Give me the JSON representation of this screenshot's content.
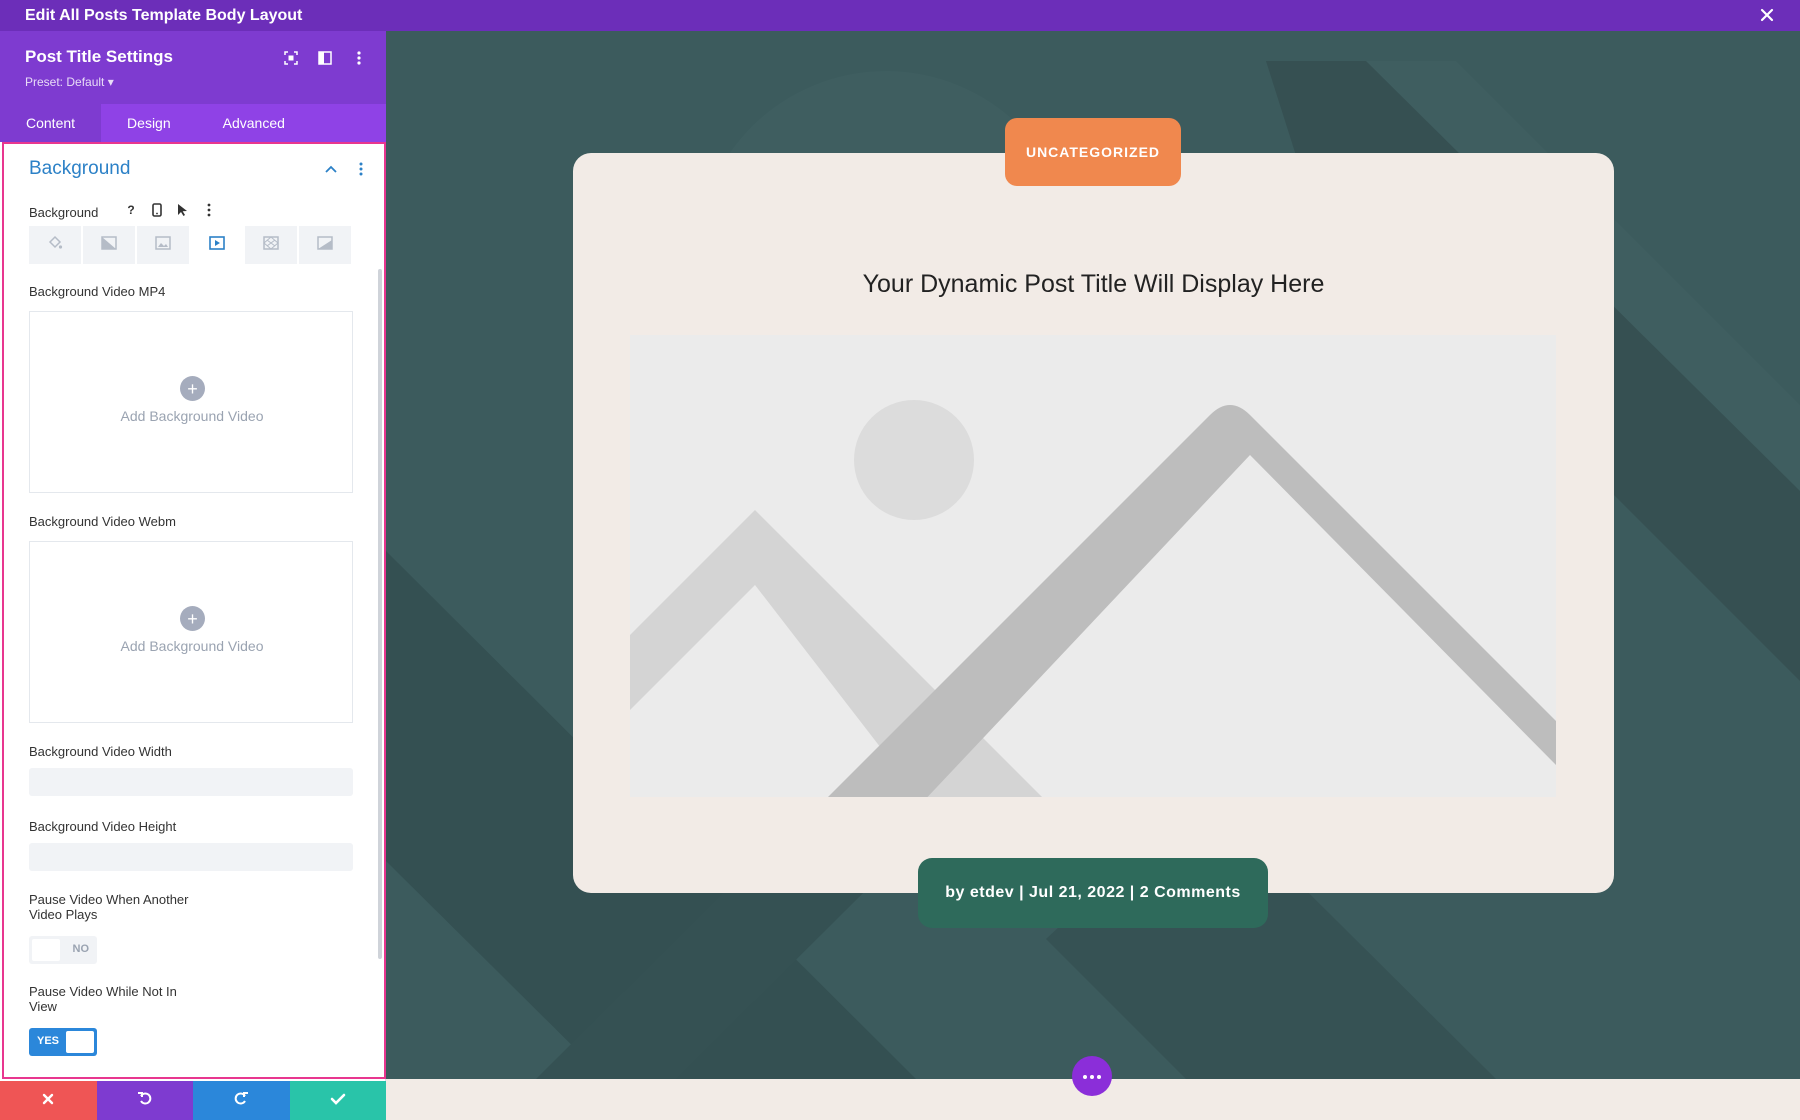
{
  "window": {
    "title": "Edit All Posts Template Body Layout"
  },
  "panel": {
    "title": "Post Title Settings",
    "preset": "Preset: Default ▾",
    "tabs": [
      {
        "label": "Content",
        "active": true
      },
      {
        "label": "Design",
        "active": false
      },
      {
        "label": "Advanced",
        "active": false
      }
    ],
    "section": {
      "title": "Background",
      "background_label": "Background",
      "help_glyph": "?",
      "video_mp4_label": "Background Video MP4",
      "video_webm_label": "Background Video Webm",
      "add_video_text": "Add Background Video",
      "add_plus": "+",
      "video_width_label": "Background Video Width",
      "video_width_value": "",
      "video_height_label": "Background Video Height",
      "video_height_value": "",
      "pause_other_label_1": "Pause Video When Another",
      "pause_other_label_2": "Video Plays",
      "pause_other_value": "NO",
      "pause_view_label_1": "Pause Video While Not In",
      "pause_view_label_2": "View",
      "pause_view_value": "YES"
    }
  },
  "canvas": {
    "category": "UNCATEGORIZED",
    "post_title": "Your Dynamic Post Title Will Display Here",
    "meta": "by etdev | Jul 21, 2022 | 2 Comments"
  },
  "colors": {
    "topbar": "#6c2eb9",
    "panel_header": "#7e3bd0",
    "accent_blue": "#2c81c7",
    "canvas_bg": "#3c5b5d",
    "badge_orange": "#f0884e",
    "badge_green": "#2e6a5b",
    "btn_discard": "#ef5555",
    "btn_undo": "#7e3bd0",
    "btn_redo": "#2b87da",
    "btn_save": "#29c4a9"
  }
}
